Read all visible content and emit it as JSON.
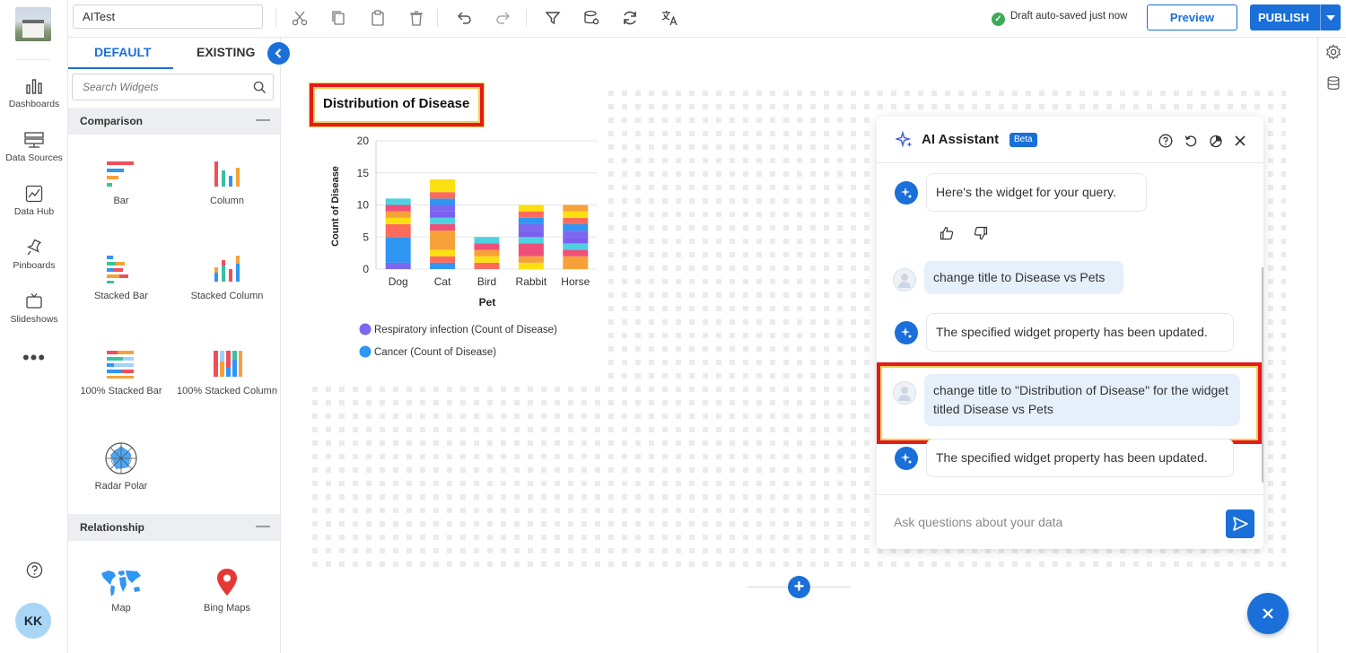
{
  "app": {
    "dashboard_name": "AITest"
  },
  "rail": {
    "items": [
      {
        "label": "Dashboards"
      },
      {
        "label": "Data Sources"
      },
      {
        "label": "Data Hub"
      },
      {
        "label": "Pinboards"
      },
      {
        "label": "Slideshows"
      }
    ],
    "more": "•••",
    "user_initials": "KK"
  },
  "toolbar": {
    "status": "Draft auto-saved just now",
    "preview": "Preview",
    "publish": "PUBLISH"
  },
  "widget_panel": {
    "tabs": [
      "DEFAULT",
      "EXISTING"
    ],
    "search_placeholder": "Search Widgets",
    "sections": [
      {
        "title": "Comparison",
        "toggle": "—",
        "items": [
          "Bar",
          "Column",
          "Stacked Bar",
          "Stacked Column",
          "100% Stacked Bar",
          "100% Stacked Column",
          "Radar Polar"
        ]
      },
      {
        "title": "Relationship",
        "toggle": "—",
        "items": [
          "Map",
          "Bing Maps"
        ]
      }
    ]
  },
  "chart_data": {
    "type": "bar",
    "stacked": true,
    "title": "Distribution of Disease",
    "xlabel": "Pet",
    "ylabel": "Count of Disease",
    "ylim": [
      0,
      20
    ],
    "yticks": [
      0,
      5,
      10,
      15,
      20
    ],
    "categories": [
      "Dog",
      "Cat",
      "Bird",
      "Rabbit",
      "Horse"
    ],
    "totals": [
      11,
      14,
      5,
      10,
      10
    ],
    "legend": [
      {
        "name": "Respiratory infection (Count of Disease)",
        "color": "#7b68ee"
      },
      {
        "name": "Cancer (Count of Disease)",
        "color": "#2f96f3"
      }
    ],
    "palette": [
      "#7b68ee",
      "#2f96f3",
      "#ff6b5b",
      "#fbe011",
      "#f7a13a",
      "#ef4f7a",
      "#4fd1e0",
      "#7d5ff0"
    ],
    "segments": [
      [
        1,
        4,
        2,
        1,
        1,
        1,
        1
      ],
      [
        1,
        1,
        1,
        3,
        1,
        1,
        1,
        1,
        1,
        1,
        2
      ],
      [
        1,
        1,
        1,
        1,
        1
      ],
      [
        1,
        1,
        2,
        1,
        1,
        1,
        1,
        1,
        1
      ],
      [
        2,
        1,
        1,
        1,
        1,
        1,
        1,
        1,
        1
      ]
    ]
  },
  "ai_assistant": {
    "title": "AI Assistant",
    "badge": "Beta",
    "messages": [
      {
        "role": "bot",
        "text": "Here's the widget for your query."
      },
      {
        "role": "user",
        "text": "change title to Disease vs Pets"
      },
      {
        "role": "bot",
        "text": "The specified widget property has been updated."
      },
      {
        "role": "user",
        "text": "change title to \"Distribution of Disease\" for the widget titled Disease vs Pets"
      },
      {
        "role": "bot",
        "text": "The specified widget property has been updated."
      }
    ],
    "input_placeholder": "Ask questions about your data"
  },
  "colors": {
    "accent": "#1a6fd8",
    "highlight": "#e31b1b",
    "success": "#3bab55"
  }
}
